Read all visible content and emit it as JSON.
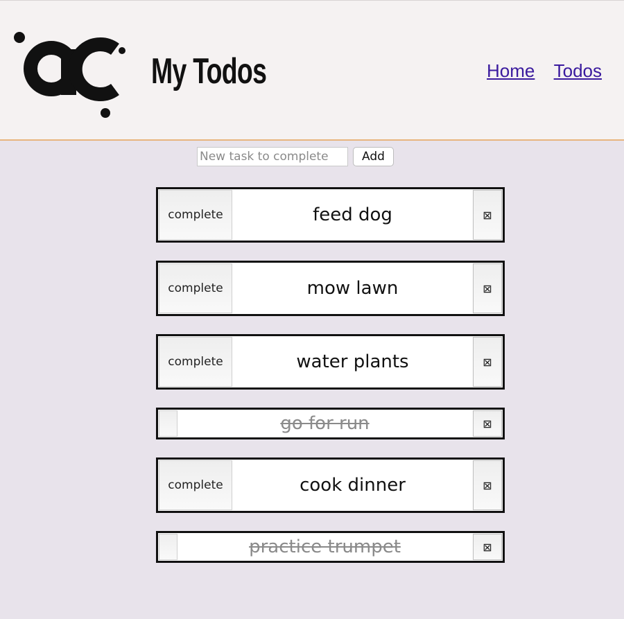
{
  "header": {
    "title": "My Todos",
    "nav": [
      {
        "label": "Home"
      },
      {
        "label": "Todos"
      }
    ],
    "colors": {
      "header_bg": "#f5f2f2",
      "header_border": "#e8b57e",
      "link": "#3a1a9e"
    }
  },
  "new_task": {
    "placeholder": "New task to complete",
    "value": "",
    "add_label": "Add"
  },
  "todos": [
    {
      "text": "feed dog",
      "completed": false,
      "complete_label": "complete",
      "delete_icon": "⊠"
    },
    {
      "text": "mow lawn",
      "completed": false,
      "complete_label": "complete",
      "delete_icon": "⊠"
    },
    {
      "text": "water plants",
      "completed": false,
      "complete_label": "complete",
      "delete_icon": "⊠"
    },
    {
      "text": "go for run",
      "completed": true,
      "complete_label": "",
      "delete_icon": "⊠"
    },
    {
      "text": "cook dinner",
      "completed": false,
      "complete_label": "complete",
      "delete_icon": "⊠"
    },
    {
      "text": "practice trumpet",
      "completed": true,
      "complete_label": "",
      "delete_icon": "⊠"
    }
  ],
  "page_background": "#e8e3eb"
}
